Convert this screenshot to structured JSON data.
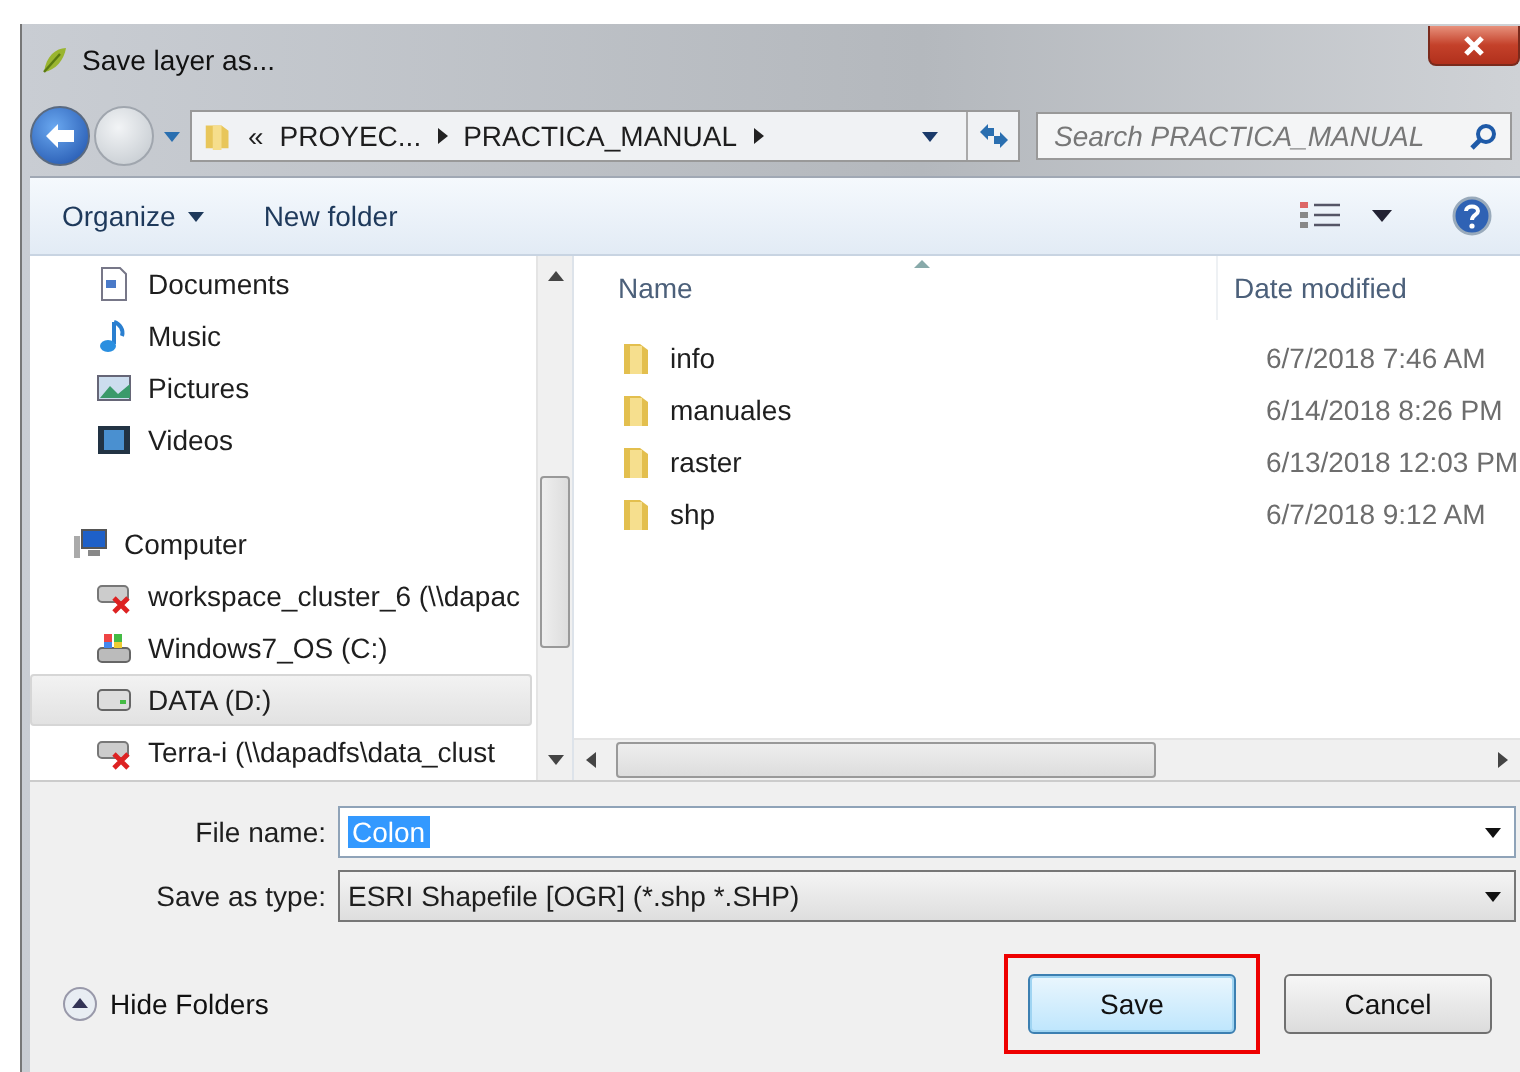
{
  "window": {
    "title": "Save layer as..."
  },
  "address": {
    "overflow": "«",
    "crumbs": [
      "PROYEC...",
      "PRACTICA_MANUAL"
    ],
    "search_placeholder": "Search PRACTICA_MANUAL"
  },
  "toolbar": {
    "organize": "Organize",
    "new_folder": "New folder"
  },
  "nav": [
    {
      "label": "Documents",
      "kind": "documents",
      "selected": false
    },
    {
      "label": "Music",
      "kind": "music",
      "selected": false
    },
    {
      "label": "Pictures",
      "kind": "pictures",
      "selected": false
    },
    {
      "label": "Videos",
      "kind": "videos",
      "selected": false
    },
    {
      "label": "Computer",
      "kind": "computer",
      "selected": false,
      "children": [
        {
          "label": "workspace_cluster_6 (\\\\dapac",
          "kind": "network",
          "selected": false
        },
        {
          "label": "Windows7_OS (C:)",
          "kind": "system",
          "selected": false
        },
        {
          "label": "DATA (D:)",
          "kind": "drive",
          "selected": true
        },
        {
          "label": "Terra-i (\\\\dapadfs\\data_clust",
          "kind": "network",
          "selected": false
        }
      ]
    }
  ],
  "files": {
    "columns": [
      "Name",
      "Date modified"
    ],
    "rows": [
      {
        "name": "info",
        "date": "6/7/2018 7:46 AM"
      },
      {
        "name": "manuales",
        "date": "6/14/2018 8:26 PM"
      },
      {
        "name": "raster",
        "date": "6/13/2018 12:03 PM"
      },
      {
        "name": "shp",
        "date": "6/7/2018 9:12 AM"
      }
    ]
  },
  "form": {
    "file_name_label": "File name:",
    "file_name": "Colon",
    "type_label": "Save as type:",
    "type": "ESRI Shapefile [OGR] (*.shp *.SHP)"
  },
  "hide_folders": "Hide Folders",
  "buttons": [
    {
      "label": "Save",
      "highlighted": true
    },
    {
      "label": "Cancel",
      "highlighted": false
    }
  ]
}
